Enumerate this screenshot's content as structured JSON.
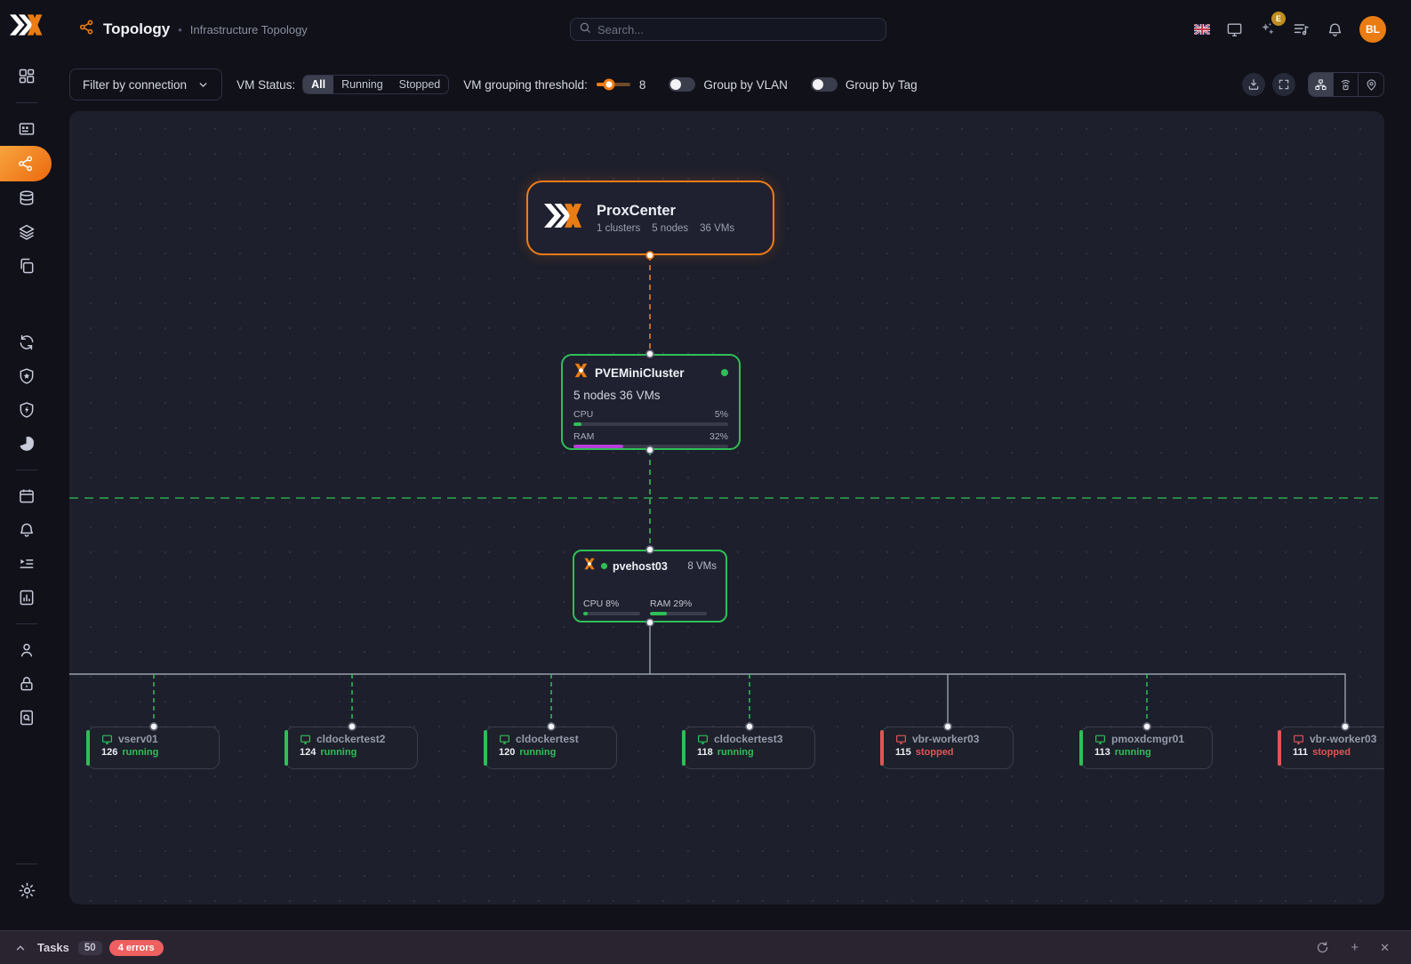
{
  "header": {
    "title": "Topology",
    "separator": "•",
    "subtitle": "Infrastructure Topology",
    "search_placeholder": "Search...",
    "notification_badge": "E",
    "avatar_initials": "BL"
  },
  "toolbar": {
    "filter_label": "Filter by connection",
    "vm_status": {
      "label": "VM Status:",
      "options": [
        "All",
        "Running",
        "Stopped"
      ],
      "selected": "All"
    },
    "threshold_label": "VM grouping threshold:",
    "threshold_value": "8",
    "group_by_vlan_label": "Group by VLAN",
    "group_by_vlan_on": false,
    "group_by_tag_label": "Group by Tag",
    "group_by_tag_on": false
  },
  "canvas": {
    "root": {
      "name": "ProxCenter",
      "stats": [
        "1 clusters",
        "5 nodes",
        "36 VMs"
      ]
    },
    "cluster": {
      "name": "PVEMiniCluster",
      "meta": "5 nodes 36 VMs",
      "cpu_label": "CPU",
      "cpu_value": "5%",
      "cpu_pct": 5,
      "ram_label": "RAM",
      "ram_value": "32%",
      "ram_pct": 32
    },
    "host": {
      "name": "pvehost03",
      "vm_count": "8 VMs",
      "cpu_label": "CPU 8%",
      "cpu_pct": 8,
      "ram_label": "RAM 29%",
      "ram_pct": 29
    },
    "vms": [
      {
        "name": "vserv01",
        "id": "126",
        "status": "running"
      },
      {
        "name": "cldockertest2",
        "id": "124",
        "status": "running"
      },
      {
        "name": "cldockertest",
        "id": "120",
        "status": "running"
      },
      {
        "name": "cldockertest3",
        "id": "118",
        "status": "running"
      },
      {
        "name": "vbr-worker03",
        "id": "115",
        "status": "stopped"
      },
      {
        "name": "pmoxdcmgr01",
        "id": "113",
        "status": "running"
      },
      {
        "name": "vbr-worker03",
        "id": "111",
        "status": "stopped"
      }
    ]
  },
  "statusbar": {
    "tasks_label": "Tasks",
    "tasks_count": "50",
    "errors_label": "4 errors"
  },
  "colors": {
    "accent_orange": "#f07c16",
    "running_green": "#2fbf56",
    "stopped_red": "#e25555",
    "ram_purple": "#b43fd9"
  },
  "icons": {
    "plus_glyph": "+",
    "close_glyph": "✕"
  }
}
